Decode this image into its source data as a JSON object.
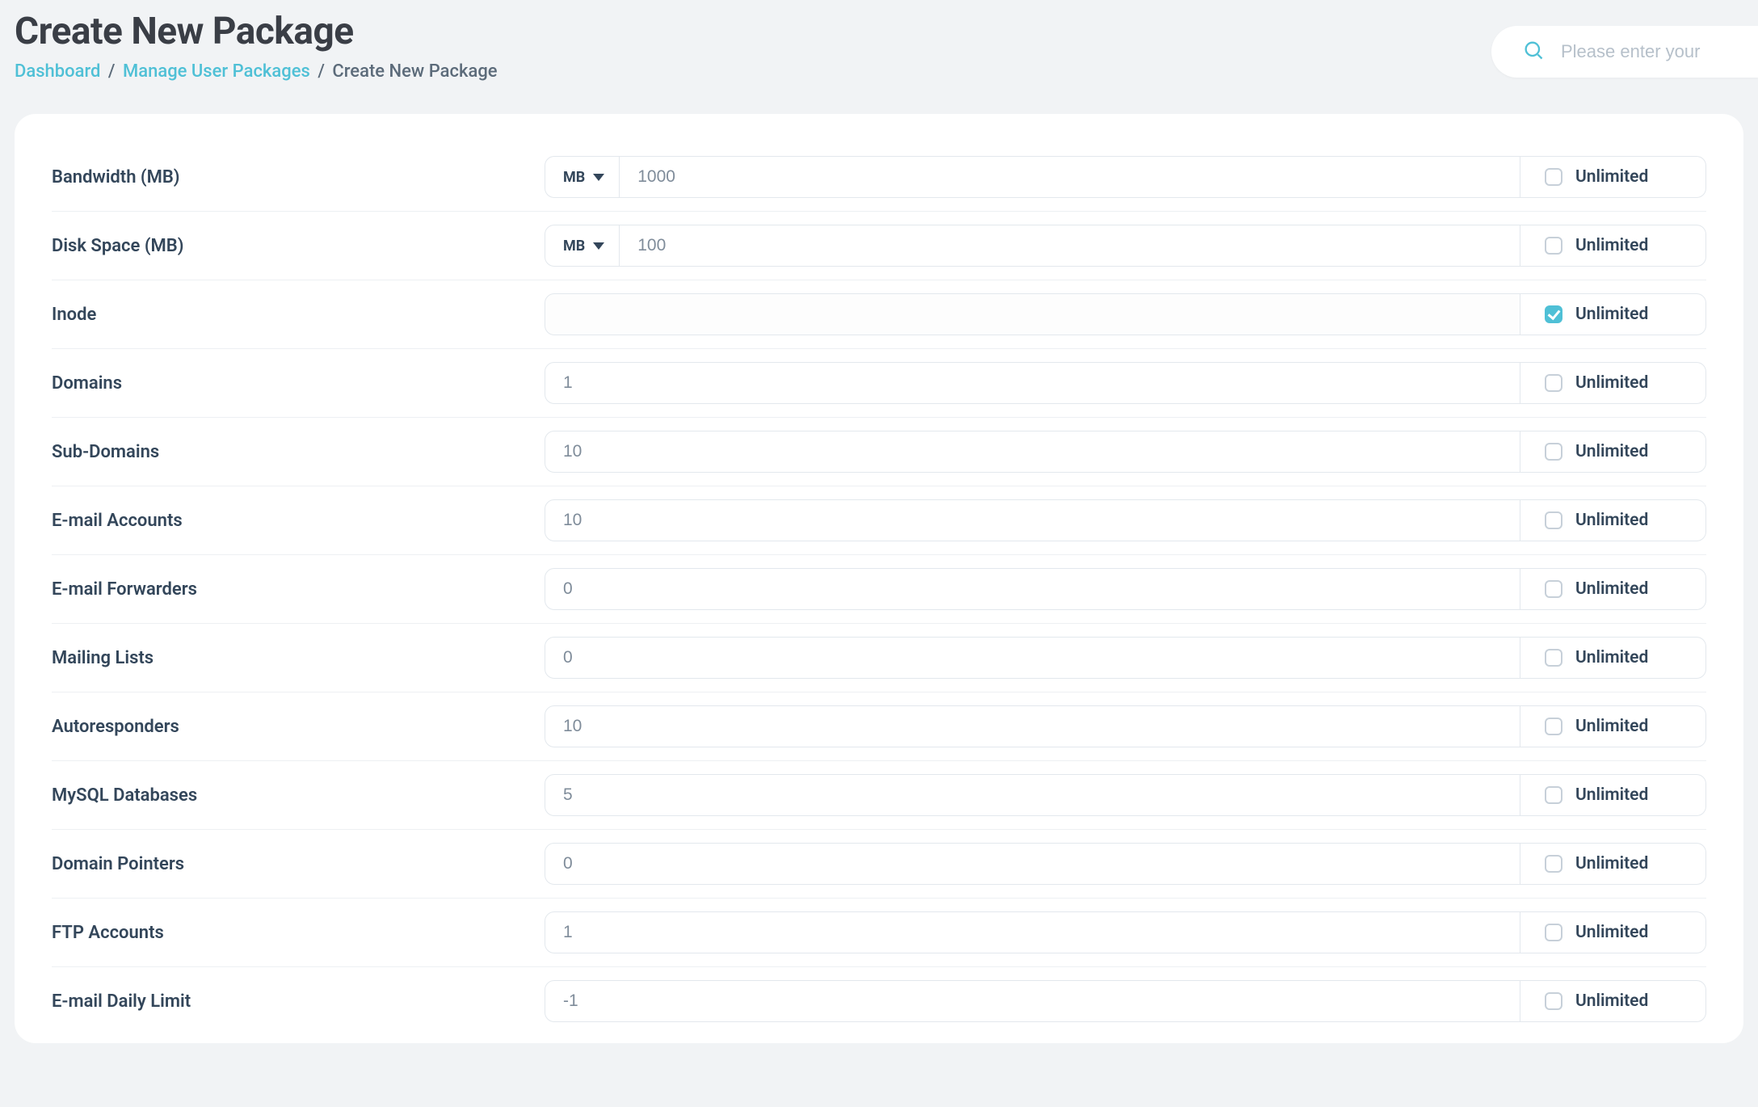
{
  "header": {
    "title": "Create New Package"
  },
  "breadcrumb": {
    "dashboard": "Dashboard",
    "manage": "Manage User Packages",
    "current": "Create New Package",
    "sep": "/"
  },
  "search": {
    "placeholder": "Please enter your"
  },
  "unlimited_label": "Unlimited",
  "rows": [
    {
      "label": "Bandwidth (MB)",
      "unit": "MB",
      "value": "1000",
      "unlimited": false
    },
    {
      "label": "Disk Space (MB)",
      "unit": "MB",
      "value": "100",
      "unlimited": false
    },
    {
      "label": "Inode",
      "unit": null,
      "value": "",
      "unlimited": true
    },
    {
      "label": "Domains",
      "unit": null,
      "value": "1",
      "unlimited": false
    },
    {
      "label": "Sub-Domains",
      "unit": null,
      "value": "10",
      "unlimited": false
    },
    {
      "label": "E-mail Accounts",
      "unit": null,
      "value": "10",
      "unlimited": false
    },
    {
      "label": "E-mail Forwarders",
      "unit": null,
      "value": "0",
      "unlimited": false
    },
    {
      "label": "Mailing Lists",
      "unit": null,
      "value": "0",
      "unlimited": false
    },
    {
      "label": "Autoresponders",
      "unit": null,
      "value": "10",
      "unlimited": false
    },
    {
      "label": "MySQL Databases",
      "unit": null,
      "value": "5",
      "unlimited": false
    },
    {
      "label": "Domain Pointers",
      "unit": null,
      "value": "0",
      "unlimited": false
    },
    {
      "label": "FTP Accounts",
      "unit": null,
      "value": "1",
      "unlimited": false
    },
    {
      "label": "E-mail Daily Limit",
      "unit": null,
      "value": "-1",
      "unlimited": false
    }
  ]
}
